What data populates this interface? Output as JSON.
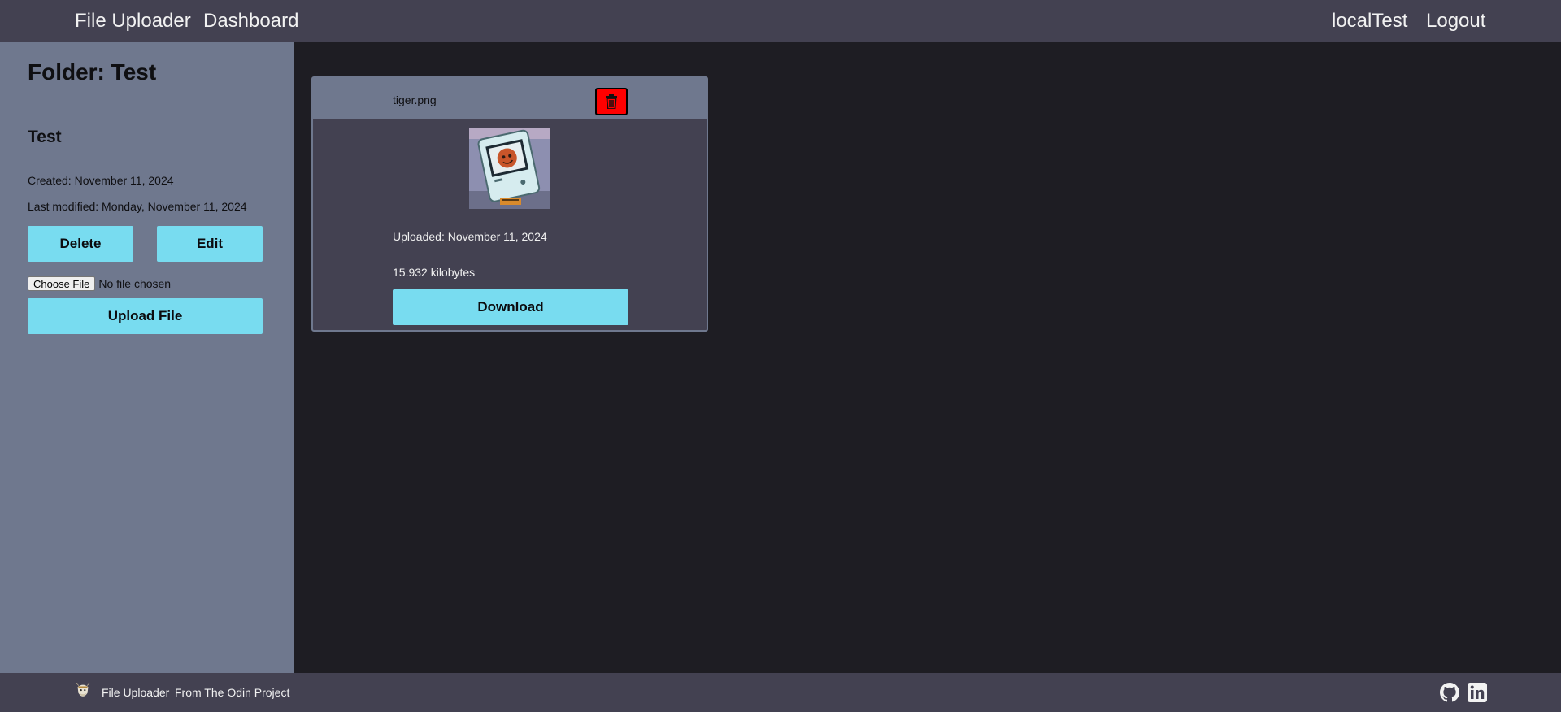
{
  "header": {
    "brand": "File Uploader",
    "dashboard": "Dashboard",
    "username": "localTest",
    "logout": "Logout"
  },
  "sidebar": {
    "folder_title": "Folder: Test",
    "folder_name": "Test",
    "created": "Created: November 11, 2024",
    "last_modified": "Last modified: Monday, November 11, 2024",
    "delete_label": "Delete",
    "edit_label": "Edit",
    "choose_file_label": "Choose File",
    "no_file_label": "No file chosen",
    "upload_label": "Upload File"
  },
  "file_card": {
    "filename": "tiger.png",
    "uploaded": "Uploaded: November 11, 2024",
    "size": "15.932 kilobytes",
    "download_label": "Download",
    "delete_icon": "trash-icon"
  },
  "footer": {
    "brand": "File Uploader",
    "credit": "From The Odin Project",
    "icons": [
      "github-icon",
      "linkedin-icon"
    ]
  },
  "colors": {
    "header_bg": "#434151",
    "sidebar_bg": "#6f788e",
    "main_bg": "#1e1d23",
    "accent_button": "#78dcf0",
    "danger": "#ff0000"
  }
}
